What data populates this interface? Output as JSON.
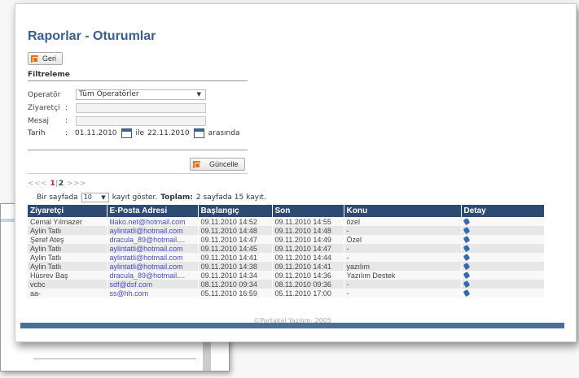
{
  "page": {
    "title": "Raporlar - Oturumlar",
    "back_label": "Geri",
    "footer": "©Portakal Yazılım, 2005"
  },
  "filter": {
    "section_title": "Filtreleme",
    "operator_label": "Operatör",
    "operator_value": "Tüm Operatörler",
    "visitor_label": "Ziyaretçi",
    "message_label": "Mesaj",
    "date_label": "Tarih",
    "colon": ":",
    "date_from": "01.11.2010",
    "date_between": "ile",
    "date_to": "22.11.2010",
    "date_suffix": "arasında",
    "update_label": "Güncelle"
  },
  "pager": {
    "first": "<<<",
    "page1": "1",
    "sep": "|",
    "page2": "2",
    "next": ">>>"
  },
  "perpage": {
    "prefix": "Bir sayfada",
    "value": "10",
    "suffix": "kayıt göster.",
    "total_label": "Toplam:",
    "total_text": "2 sayfada 15 kayıt."
  },
  "table": {
    "columns": [
      "Ziyaretçi",
      "E-Posta Adresi",
      "Başlangıç",
      "Son",
      "Konu",
      "Detay"
    ],
    "rows": [
      {
        "visitor": "Cemal Yılmazer",
        "email": "lilako.net@hotmail.com",
        "start": "09.11.2010 14:52",
        "end": "09.11.2010 14:55",
        "subject": "özel"
      },
      {
        "visitor": "Aylin Tatlı",
        "email": "aylintatli@hotmail.com",
        "start": "09.11.2010 14:48",
        "end": "09.11.2010 14:48",
        "subject": "-"
      },
      {
        "visitor": "Şeref Ateş",
        "email": "dracula_89@hotmail....",
        "start": "09.11.2010 14:47",
        "end": "09.11.2010 14:49",
        "subject": "Özel"
      },
      {
        "visitor": "Aylin Tatlı",
        "email": "aylintatli@hotmail.com",
        "start": "09.11.2010 14:45",
        "end": "09.11.2010 14:47",
        "subject": "-"
      },
      {
        "visitor": "Aylin Tatlı",
        "email": "aylintatli@hotmail.com",
        "start": "09.11.2010 14:41",
        "end": "09.11.2010 14:44",
        "subject": "-"
      },
      {
        "visitor": "Aylin Tatlı",
        "email": "aylintatli@hotmail.com",
        "start": "09.11.2010 14:38",
        "end": "09.11.2010 14:41",
        "subject": "yazılım"
      },
      {
        "visitor": "Hüsrev Baş",
        "email": "dracula_89@hotmail....",
        "start": "09.11.2010 14:34",
        "end": "09.11.2010 14:36",
        "subject": "Yazılım Destek"
      },
      {
        "visitor": "vcbc",
        "email": "sdf@dsf.com",
        "start": "08.11.2010 09:34",
        "end": "08.11.2010 09:36",
        "subject": "-"
      },
      {
        "visitor": "aa-",
        "email": "ss@hh.com",
        "start": "05.11.2010 16:59",
        "end": "05.11.2010 17:00",
        "subject": "-"
      }
    ]
  },
  "icons": {
    "button_icon": "orange-square-icon",
    "calendar": "calendar-icon",
    "detail": "pin-icon",
    "dropdown": "chevron-down-icon"
  },
  "colors": {
    "title": "#3a5f8c",
    "header_bg": "#2d4a73",
    "button_icon": "#e86f1b",
    "link": "#4a4ac8"
  }
}
